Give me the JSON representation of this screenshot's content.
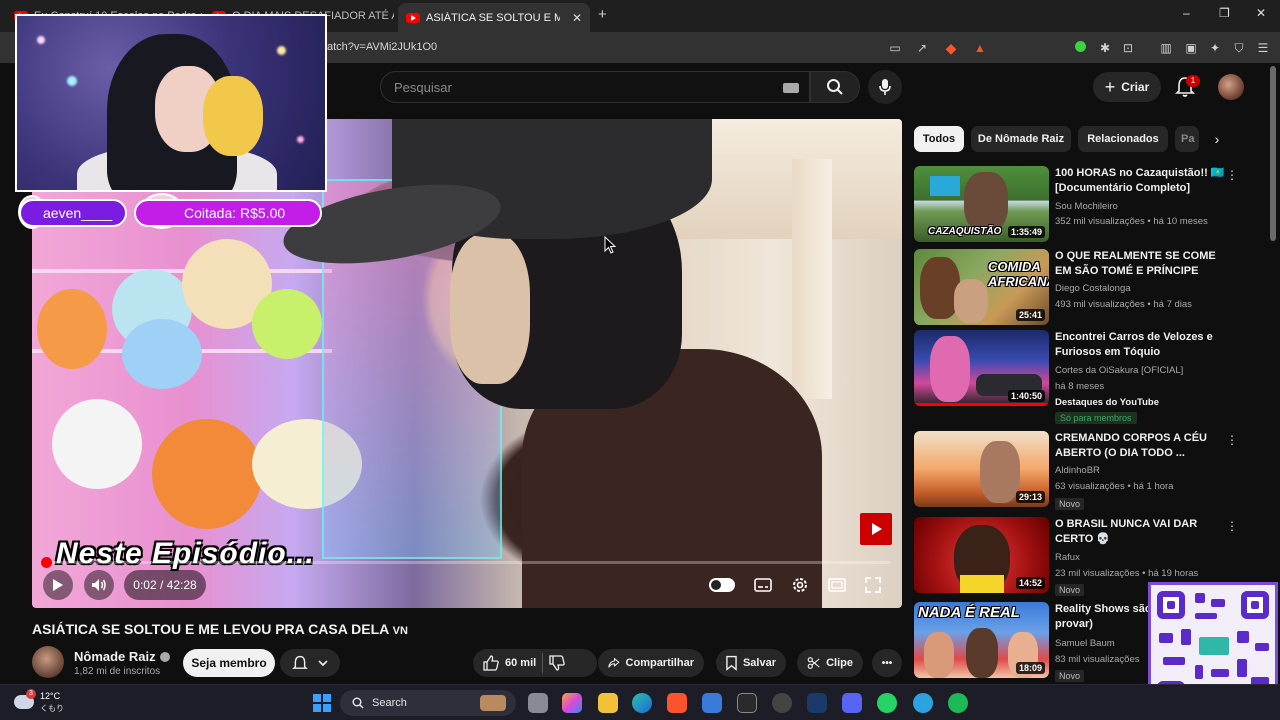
{
  "browser": {
    "tabs": [
      {
        "title": "Eu Construí 10 Escolas no Pedra de...",
        "active": false
      },
      {
        "title": "O DIA MAIS DESAFIADOR ATÉ AQUI...",
        "active": false
      },
      {
        "title": "ASIÁTICA SE SOLTOU E ME LEVOU...",
        "active": true
      }
    ],
    "new_tab_label": "+",
    "url": "atch?v=AVMi2JUk1O0",
    "brave_shield_count": "1",
    "brave_rewards_count": "1",
    "window_controls": [
      "–",
      "❐",
      "✕"
    ]
  },
  "youtube": {
    "search_placeholder": "Pesquisar",
    "create_label": "Criar",
    "notification_count": "1"
  },
  "overlay": {
    "chat_username": "aeven____",
    "donation_text": "Coitada: R$5.00"
  },
  "player": {
    "caption": "Neste Episódio...",
    "time_current": "0:02",
    "time_total": "42:28",
    "time_display": "0:02 / 42:28",
    "progress_fraction": 0.001
  },
  "video": {
    "title": "ASIÁTICA SE SOLTOU E ME LEVOU PRA CASA DELA",
    "title_tag": "VN",
    "channel_name": "Nômade Raiz",
    "subscribers": "1,82 mi de inscritos",
    "join_label": "Seja membro",
    "likes": "60 mil",
    "share_label": "Compartilhar",
    "save_label": "Salvar",
    "clip_label": "Clipe",
    "more_label": "•••"
  },
  "sidebar": {
    "chips": [
      "Todos",
      "De Nômade Raiz",
      "Relacionados",
      "Pa"
    ],
    "items": [
      {
        "title": "100 HORAS no Cazaquistão!! 🇰🇿 [Documentário Completo]",
        "channel": "Sou Mochileiro",
        "meta": "352 mil visualizações • há 10 meses",
        "duration": "1:35:49",
        "thumb_text": "CAZAQUISTÃO",
        "badge": ""
      },
      {
        "title": "O QUE REALMENTE SE COME EM SÃO TOMÉ E PRÍNCIPE",
        "channel": "Diego Costalonga",
        "meta": "493 mil visualizações • há 7 dias",
        "duration": "25:41",
        "thumb_text": "COMIDA AFRICANA?",
        "badge": ""
      },
      {
        "title": "Encontrei Carros de Velozes e Furiosos em Tóquio",
        "channel": "Cortes da OiSakura [OFICIAL]",
        "meta": "há 8 meses",
        "extra": "Destaques do YouTube",
        "members": "Só para membros",
        "duration": "1:40:50",
        "thumb_text": "",
        "badge": ""
      },
      {
        "title": "CREMANDO CORPOS A CÉU ABERTO (O DIA TODO ...",
        "channel": "AldinhoBR",
        "meta": "63 visualizações • há 1 hora",
        "duration": "29:13",
        "thumb_text": "",
        "badge": "Novo"
      },
      {
        "title": "O BRASIL NUNCA VAI DAR CERTO 💀",
        "channel": "Rafux",
        "meta": "23 mil visualizações • há 19 horas",
        "duration": "14:52",
        "thumb_text": "",
        "badge": "Novo"
      },
      {
        "title": "Reality Shows são ... eu vou provar)",
        "channel": "Samuel Baum",
        "meta": "83 mil visualizações",
        "duration": "18:09",
        "thumb_text": "NADA É REAL",
        "badge": "Novo"
      }
    ]
  },
  "taskbar": {
    "temperature": "12°C",
    "weather_desc": "くもり",
    "search_label": "Search",
    "weather_badge": "3"
  },
  "colors": {
    "yt_background": "#0f0f0f",
    "accent_red": "#ff0000",
    "overlay_purple": "#7a1de0",
    "donation_magenta": "#c21ee8",
    "qr_purple": "#5b2bc9"
  }
}
